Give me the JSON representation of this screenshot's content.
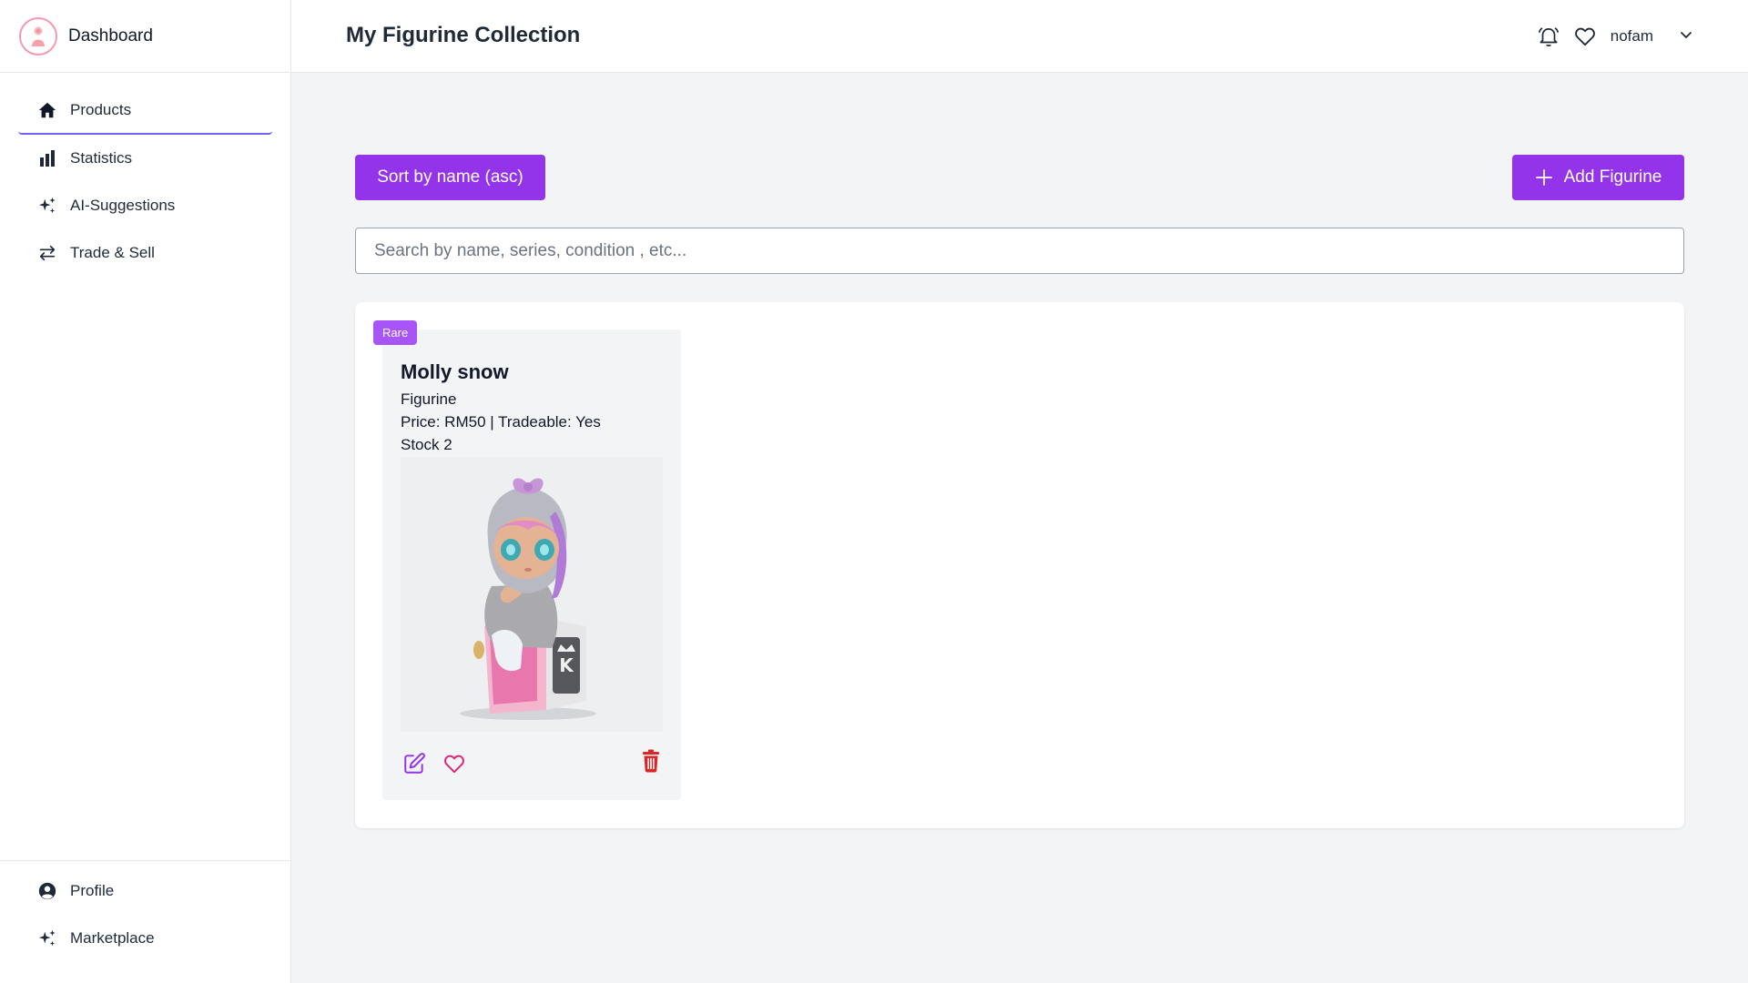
{
  "sidebar": {
    "brand": "Dashboard",
    "items": [
      {
        "label": "Products",
        "icon": "home-icon",
        "active": true
      },
      {
        "label": "Statistics",
        "icon": "bar-chart-icon"
      },
      {
        "label": "AI-Suggestions",
        "icon": "sparkles-icon"
      },
      {
        "label": "Trade & Sell",
        "icon": "arrows-exchange-icon"
      }
    ],
    "bottom_items": [
      {
        "label": "Profile",
        "icon": "user-circle-icon"
      },
      {
        "label": "Marketplace",
        "icon": "sparkles-icon"
      }
    ]
  },
  "header": {
    "title": "My Figurine Collection",
    "username": "nofam"
  },
  "toolbar": {
    "sort_label": "Sort by name (asc)",
    "add_label": "Add Figurine"
  },
  "search": {
    "placeholder": "Search by name, series, condition , etc...",
    "value": ""
  },
  "products": [
    {
      "badge": "Rare",
      "name": "Molly snow",
      "type": "Figurine",
      "price_line": "Price: RM50 | Tradeable: Yes",
      "stock_line": "Stock 2"
    }
  ],
  "colors": {
    "accent": "#9333ea",
    "badge": "#a855f7",
    "delete": "#dc2626",
    "favorite": "#db2777",
    "active_underline": "#6d63f0"
  }
}
